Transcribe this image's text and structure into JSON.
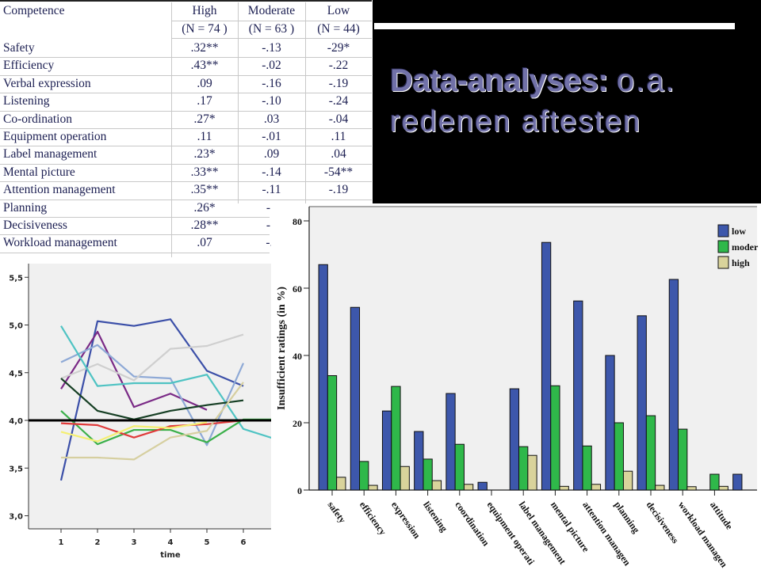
{
  "table": {
    "header": {
      "competence_label": "Competence",
      "columns": [
        {
          "label": "High",
          "n": "(N = 74 )"
        },
        {
          "label": "Moderate",
          "n": "(N = 63 )"
        },
        {
          "label": "Low",
          "n": "(N = 44)"
        }
      ]
    },
    "rows": [
      {
        "name": "Safety",
        "values": [
          ".32**",
          "-.13",
          "-29*"
        ]
      },
      {
        "name": "Efficiency",
        "values": [
          ".43**",
          "-.02",
          "-.22"
        ]
      },
      {
        "name": "Verbal expression",
        "values": [
          ".09",
          "-.16",
          "-.19"
        ]
      },
      {
        "name": "Listening",
        "values": [
          ".17",
          "-.10",
          "-.24"
        ]
      },
      {
        "name": "Co-ordination",
        "values": [
          ".27*",
          ".03",
          "-.04"
        ]
      },
      {
        "name": "Equipment operation",
        "values": [
          ".11",
          "-.01",
          ".11"
        ]
      },
      {
        "name": "Label management",
        "values": [
          ".23*",
          ".09",
          ".04"
        ]
      },
      {
        "name": "Mental picture",
        "values": [
          ".33**",
          "-.14",
          "-54**"
        ]
      },
      {
        "name": "Attention management",
        "values": [
          ".35**",
          "-.11",
          "-.19"
        ]
      },
      {
        "name": "Planning",
        "values": [
          ".26*",
          "-.:",
          ""
        ]
      },
      {
        "name": "Decisiveness",
        "values": [
          ".28**",
          "-.:",
          ""
        ]
      },
      {
        "name": "Workload management",
        "values": [
          ".07",
          "-.(",
          ""
        ]
      }
    ]
  },
  "slide": {
    "title_bold": "Data-analyses:",
    "title_rest": "o.a.",
    "subtitle": "redenen aftesten",
    "text_color": "#7171a8"
  },
  "chart_data": [
    {
      "type": "line",
      "title": "",
      "xlabel": "time",
      "ylabel": "",
      "x": [
        1,
        2,
        3,
        4,
        5,
        6
      ],
      "x_tick_labels": [
        "1",
        "2",
        "3",
        "4",
        "5",
        "6"
      ],
      "y_ticks": [
        3.0,
        3.5,
        4.0,
        4.5,
        5.0,
        5.5
      ],
      "y_tick_labels": [
        "3,0",
        "3,5",
        "4,0",
        "4,5",
        "5,0",
        "5,5"
      ],
      "ylim": [
        2.85,
        5.65
      ],
      "reference_line": 4.0,
      "series": [
        {
          "name": "series-dark-blue",
          "color": "#3b4fa8",
          "values": [
            3.37,
            5.04,
            4.99,
            5.06,
            4.52,
            4.36
          ]
        },
        {
          "name": "series-purple",
          "color": "#7a2a86",
          "values": [
            4.33,
            4.93,
            4.14,
            4.28,
            4.11
          ]
        },
        {
          "name": "series-steel-blue",
          "color": "#8ea9d6",
          "values": [
            4.61,
            4.79,
            4.46,
            4.44,
            3.74,
            4.6
          ]
        },
        {
          "name": "series-light-grey",
          "color": "#cfcfcf",
          "values": [
            4.44,
            4.59,
            4.42,
            4.75,
            4.78,
            4.9
          ]
        },
        {
          "name": "series-teal",
          "color": "#4fc3c3",
          "values": [
            4.99,
            4.36,
            4.39,
            4.39,
            4.48,
            3.91,
            3.79
          ]
        },
        {
          "name": "series-dark-green",
          "color": "#163f24",
          "values": [
            4.44,
            4.1,
            4.01,
            4.1,
            4.16,
            4.21
          ]
        },
        {
          "name": "series-green",
          "color": "#3bb04a",
          "values": [
            4.1,
            3.75,
            3.9,
            3.9,
            3.77,
            4.01,
            4.01
          ]
        },
        {
          "name": "series-red",
          "color": "#e03a3a",
          "values": [
            3.97,
            3.95,
            3.82,
            3.94,
            3.96,
            4.0
          ]
        },
        {
          "name": "series-yellow",
          "color": "#f4ef72",
          "values": [
            3.88,
            3.78,
            3.94,
            3.92,
            3.98
          ]
        },
        {
          "name": "series-tan",
          "color": "#d6cfa0",
          "values": [
            3.61,
            3.61,
            3.59,
            3.82,
            3.89,
            4.4
          ]
        }
      ]
    },
    {
      "type": "bar",
      "title": "",
      "xlabel": "",
      "ylabel": "Insufficient ratings (in %)",
      "ylim": [
        0,
        80
      ],
      "y_ticks": [
        0,
        20,
        40,
        60,
        80
      ],
      "categories": [
        "safety",
        "efficiency",
        "expression",
        "listening",
        "coordination",
        "equipment operati",
        "label management",
        "mental picture",
        "attention managen",
        "planning",
        "decisiveness",
        "workload managen",
        "attitude"
      ],
      "legend": {
        "placement": "top-right",
        "entries": [
          "low",
          "moder",
          "high"
        ]
      },
      "series": [
        {
          "name": "low",
          "color": "#3d57ab",
          "values": [
            67,
            54.3,
            23.5,
            17.4,
            28.7,
            2.3,
            30.1,
            73.6,
            56.2,
            40,
            51.8,
            62.6,
            0,
            4.7
          ]
        },
        {
          "name": "moder",
          "color": "#2fb84a",
          "values": [
            34,
            8.5,
            30.8,
            9.2,
            13.6,
            0,
            12.9,
            31,
            13.1,
            20,
            22.1,
            18.1,
            4.7
          ]
        },
        {
          "name": "high",
          "color": "#d9d39b",
          "values": [
            3.8,
            1.4,
            7,
            2.8,
            1.7,
            0,
            10.3,
            1.1,
            1.7,
            5.6,
            1.4,
            1,
            1.1
          ]
        }
      ]
    }
  ]
}
